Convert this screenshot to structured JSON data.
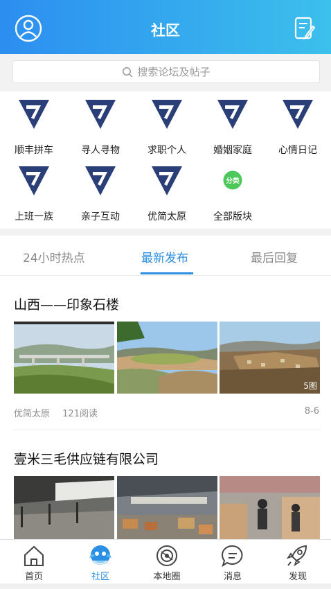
{
  "header": {
    "title": "社区",
    "left_icon": "profile-icon",
    "right_icon": "compose-icon"
  },
  "search": {
    "placeholder": "搜索论坛及帖子",
    "icon": "search-icon"
  },
  "categories": [
    {
      "label": "顺丰拼车",
      "icon": "forum-logo-icon"
    },
    {
      "label": "寻人寻物",
      "icon": "forum-logo-icon"
    },
    {
      "label": "求职个人",
      "icon": "forum-logo-icon"
    },
    {
      "label": "婚姻家庭",
      "icon": "forum-logo-icon"
    },
    {
      "label": "心情日记",
      "icon": "forum-logo-icon"
    },
    {
      "label": "上班一族",
      "icon": "forum-logo-icon"
    },
    {
      "label": "亲子互动",
      "icon": "forum-logo-icon"
    },
    {
      "label": "优简太原",
      "icon": "forum-logo-icon"
    },
    {
      "label": "全部版块",
      "icon": "all-boards-icon",
      "icon_text": "分类"
    }
  ],
  "tabs": [
    {
      "label": "24小时热点",
      "active": false
    },
    {
      "label": "最新发布",
      "active": true
    },
    {
      "label": "最后回复",
      "active": false
    }
  ],
  "posts": [
    {
      "title": "山西——印象石楼",
      "board": "优简太原",
      "reads": "121阅读",
      "date": "8-6",
      "image_count": "5图"
    },
    {
      "title": "壹米三毛供应链有限公司"
    }
  ],
  "bottom_nav": [
    {
      "label": "首页",
      "icon": "home-icon",
      "active": false
    },
    {
      "label": "社区",
      "icon": "community-icon",
      "active": true
    },
    {
      "label": "本地圈",
      "icon": "local-circle-icon",
      "active": false
    },
    {
      "label": "消息",
      "icon": "message-icon",
      "active": false
    },
    {
      "label": "发现",
      "icon": "discover-icon",
      "active": false
    }
  ],
  "colors": {
    "accent": "#2b8fe4",
    "header_start": "#2c8ef0",
    "header_end": "#3cc0ec",
    "logo": "#2a3f78",
    "all_boards": "#4cc85a"
  }
}
